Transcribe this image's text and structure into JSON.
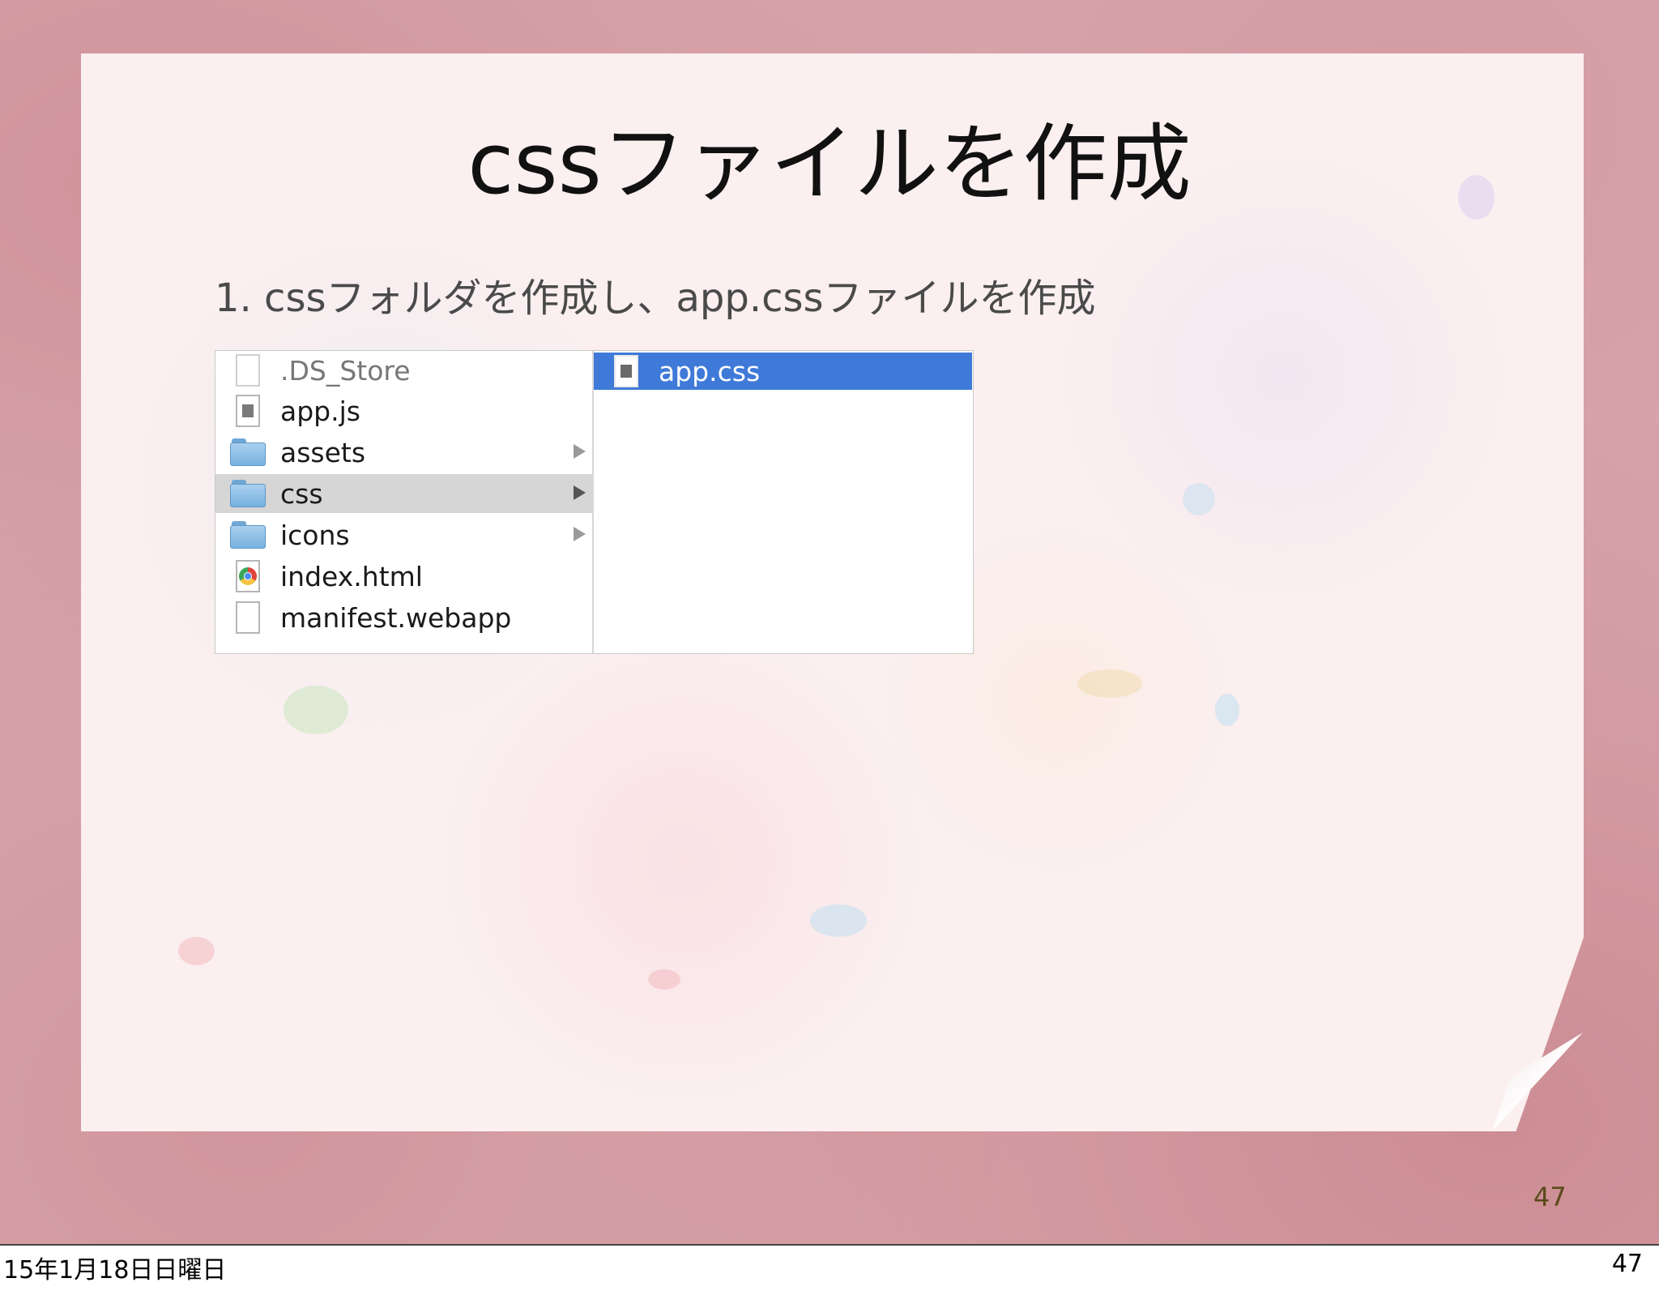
{
  "slide": {
    "title": "cssファイルを作成",
    "bullet": "1. cssフォルダを作成し、app.cssファイルを作成",
    "slide_number": "47"
  },
  "finder": {
    "column1": [
      {
        "label": ".DS_Store",
        "icon": "blank-document-icon",
        "dim": true,
        "has_children": false,
        "selected": false
      },
      {
        "label": "app.js",
        "icon": "script-document-icon",
        "dim": false,
        "has_children": false,
        "selected": false
      },
      {
        "label": "assets",
        "icon": "folder-icon",
        "dim": false,
        "has_children": true,
        "selected": false
      },
      {
        "label": "css",
        "icon": "folder-icon",
        "dim": false,
        "has_children": true,
        "selected": true
      },
      {
        "label": "icons",
        "icon": "folder-icon",
        "dim": false,
        "has_children": true,
        "selected": false
      },
      {
        "label": "index.html",
        "icon": "chrome-document-icon",
        "dim": false,
        "has_children": false,
        "selected": false
      },
      {
        "label": "manifest.webapp",
        "icon": "blank-document-icon",
        "dim": false,
        "has_children": false,
        "selected": false
      }
    ],
    "column2": [
      {
        "label": "app.css",
        "icon": "css-document-icon",
        "selected": true
      }
    ],
    "selection_color": "#3f7ad8"
  },
  "footer": {
    "date": "15年1月18日日曜日",
    "page": "47"
  }
}
